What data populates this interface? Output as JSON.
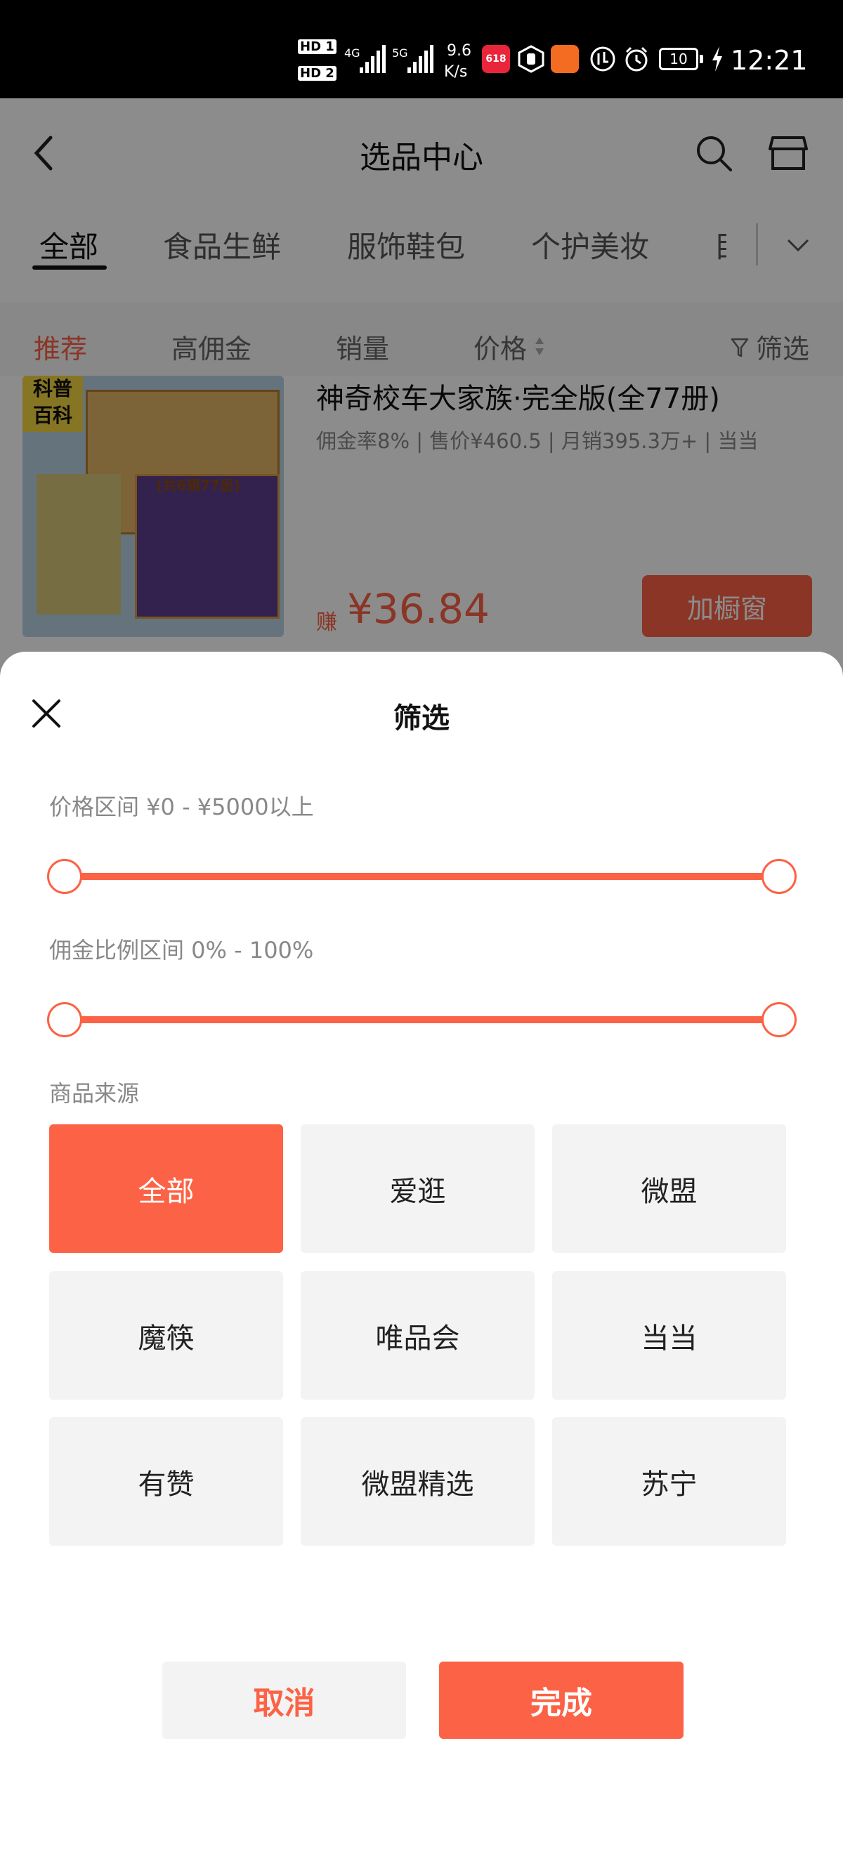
{
  "status_bar": {
    "hd1": "HD 1",
    "hd2": "HD 2",
    "net1": "4G",
    "net2": "5G",
    "speed_value": "9.6",
    "speed_unit": "K/s",
    "badge_618": "618",
    "battery": "10",
    "time": "12:21"
  },
  "nav": {
    "title": "选品中心"
  },
  "category_tabs": [
    "全部",
    "食品生鲜",
    "服饰鞋包",
    "个护美妆",
    "目"
  ],
  "sort_bar": {
    "items": [
      "推荐",
      "高佣金",
      "销量",
      "价格"
    ],
    "filter_label": "筛选"
  },
  "product": {
    "cover_tag": "科普\n百科",
    "cover_subtitle": "(共6辑77册)",
    "title": "神奇校车大家族·完全版(全77册)",
    "meta": "佣金率8%  |  售价¥460.5  |  月销395.3万+  |  当当",
    "earn_label": "赚",
    "earn_value": "¥36.84",
    "add_button": "加橱窗"
  },
  "filter_sheet": {
    "title": "筛选",
    "price_range_label": "价格区间 ¥0 - ¥5000以上",
    "price_range": {
      "min": 0,
      "max": 5000,
      "low_fraction": 0.0,
      "high_fraction": 1.0
    },
    "commission_range_label": "佣金比例区间 0% - 100%",
    "commission_range": {
      "min": 0,
      "max": 100,
      "low_fraction": 0.0,
      "high_fraction": 1.0
    },
    "source_label": "商品来源",
    "sources": [
      "全部",
      "爱逛",
      "微盟",
      "魔筷",
      "唯品会",
      "当当",
      "有赞",
      "微盟精选",
      "苏宁"
    ],
    "selected_source": "全部",
    "cancel_label": "取消",
    "done_label": "完成"
  },
  "colors": {
    "accent": "#fc6245",
    "button_gray": "#f3f3f3",
    "status_bar_bg": "#000000"
  },
  "icons": [
    "back-arrow-icon",
    "search-icon",
    "store-icon",
    "chevron-down-icon",
    "filter-funnel-icon",
    "sort-arrows-icon",
    "close-icon",
    "signal-icon",
    "alarm-icon",
    "battery-icon"
  ]
}
